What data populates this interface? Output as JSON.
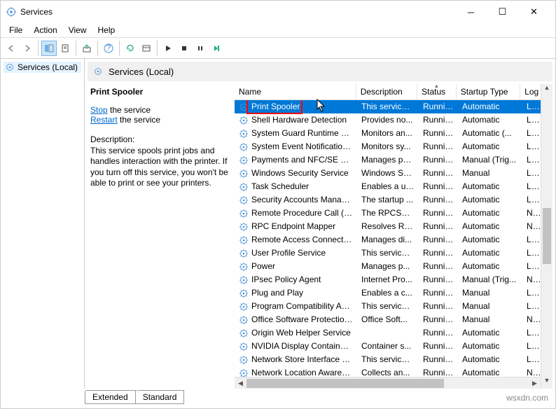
{
  "window": {
    "title": "Services"
  },
  "menu": {
    "file": "File",
    "action": "Action",
    "view": "View",
    "help": "Help"
  },
  "left": {
    "root": "Services (Local)"
  },
  "header": {
    "label": "Services (Local)"
  },
  "detail": {
    "title": "Print Spooler",
    "stop_link": "Stop",
    "stop_rest": " the service",
    "restart_link": "Restart",
    "restart_rest": " the service",
    "desc_label": "Description:",
    "desc_text": "This service spools print jobs and handles interaction with the printer. If you turn off this service, you won't be able to print or see your printers."
  },
  "columns": {
    "name": "Name",
    "desc": "Description",
    "status": "Status",
    "startup": "Startup Type",
    "logon": "Log"
  },
  "services": [
    {
      "name": "Print Spooler",
      "desc": "This service ...",
      "status": "Running",
      "startup": "Automatic",
      "logon": "Loca",
      "sel": true
    },
    {
      "name": "Shell Hardware Detection",
      "desc": "Provides no...",
      "status": "Running",
      "startup": "Automatic",
      "logon": "Loca"
    },
    {
      "name": "System Guard Runtime Mo...",
      "desc": "Monitors an...",
      "status": "Running",
      "startup": "Automatic (...",
      "logon": "Loca"
    },
    {
      "name": "System Event Notification S...",
      "desc": "Monitors sy...",
      "status": "Running",
      "startup": "Automatic",
      "logon": "Loca"
    },
    {
      "name": "Payments and NFC/SE Man...",
      "desc": "Manages pa...",
      "status": "Running",
      "startup": "Manual (Trig...",
      "logon": "Loca"
    },
    {
      "name": "Windows Security Service",
      "desc": "Windows Se...",
      "status": "Running",
      "startup": "Manual",
      "logon": "Loca"
    },
    {
      "name": "Task Scheduler",
      "desc": "Enables a us...",
      "status": "Running",
      "startup": "Automatic",
      "logon": "Loca"
    },
    {
      "name": "Security Accounts Manager",
      "desc": "The startup ...",
      "status": "Running",
      "startup": "Automatic",
      "logon": "Loca"
    },
    {
      "name": "Remote Procedure Call (RPC)",
      "desc": "The RPCSS s...",
      "status": "Running",
      "startup": "Automatic",
      "logon": "Netv"
    },
    {
      "name": "RPC Endpoint Mapper",
      "desc": "Resolves RP...",
      "status": "Running",
      "startup": "Automatic",
      "logon": "Netv"
    },
    {
      "name": "Remote Access Connection...",
      "desc": "Manages di...",
      "status": "Running",
      "startup": "Automatic",
      "logon": "Loca"
    },
    {
      "name": "User Profile Service",
      "desc": "This service ...",
      "status": "Running",
      "startup": "Automatic",
      "logon": "Loca"
    },
    {
      "name": "Power",
      "desc": "Manages p...",
      "status": "Running",
      "startup": "Automatic",
      "logon": "Loca"
    },
    {
      "name": "IPsec Policy Agent",
      "desc": "Internet Pro...",
      "status": "Running",
      "startup": "Manual (Trig...",
      "logon": "Netv"
    },
    {
      "name": "Plug and Play",
      "desc": "Enables a c...",
      "status": "Running",
      "startup": "Manual",
      "logon": "Loca"
    },
    {
      "name": "Program Compatibility Assi...",
      "desc": "This service ...",
      "status": "Running",
      "startup": "Manual",
      "logon": "Loca"
    },
    {
      "name": "Office Software Protection ...",
      "desc": "Office Soft...",
      "status": "Running",
      "startup": "Manual",
      "logon": "Netv"
    },
    {
      "name": "Origin Web Helper Service",
      "desc": "",
      "status": "Running",
      "startup": "Automatic",
      "logon": "Loca"
    },
    {
      "name": "NVIDIA Display Container LS",
      "desc": "Container s...",
      "status": "Running",
      "startup": "Automatic",
      "logon": "Loca"
    },
    {
      "name": "Network Store Interface Ser...",
      "desc": "This service ...",
      "status": "Running",
      "startup": "Automatic",
      "logon": "Loca"
    },
    {
      "name": "Network Location Awareness",
      "desc": "Collects an...",
      "status": "Running",
      "startup": "Automatic",
      "logon": "Netv"
    }
  ],
  "tabs": {
    "extended": "Extended",
    "standard": "Standard"
  },
  "watermark": "wsxdn.com"
}
